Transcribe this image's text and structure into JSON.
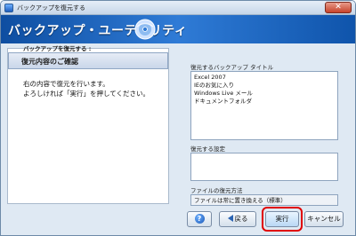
{
  "window": {
    "title": "バックアップを復元する",
    "close_glyph": "✕"
  },
  "header": {
    "title": "バックアップ・ユーティリティ",
    "disc_icon": "disc-icon"
  },
  "left": {
    "step_label": "バックアップを復元する :",
    "step_title": "復元内容のご確認",
    "instruction_line1": "右の内容で復元を行います。",
    "instruction_line2": "よろしければ「実行」を押してください。"
  },
  "right": {
    "backup_title_label": "復元するバックアップ タイトル",
    "backup_items": [
      "Excel 2007",
      "IEのお気に入り",
      "Windows Live メール",
      "ドキュメントフォルダ"
    ],
    "settings_label": "復元する設定",
    "method_label": "ファイルの復元方法",
    "method_value": "ファイルは常に置き換える（標準）"
  },
  "buttons": {
    "help": "?",
    "back": "戻る",
    "run": "実行",
    "cancel": "キャンセル"
  },
  "colors": {
    "accent": "#1f5fbf",
    "highlight": "#e00000"
  }
}
